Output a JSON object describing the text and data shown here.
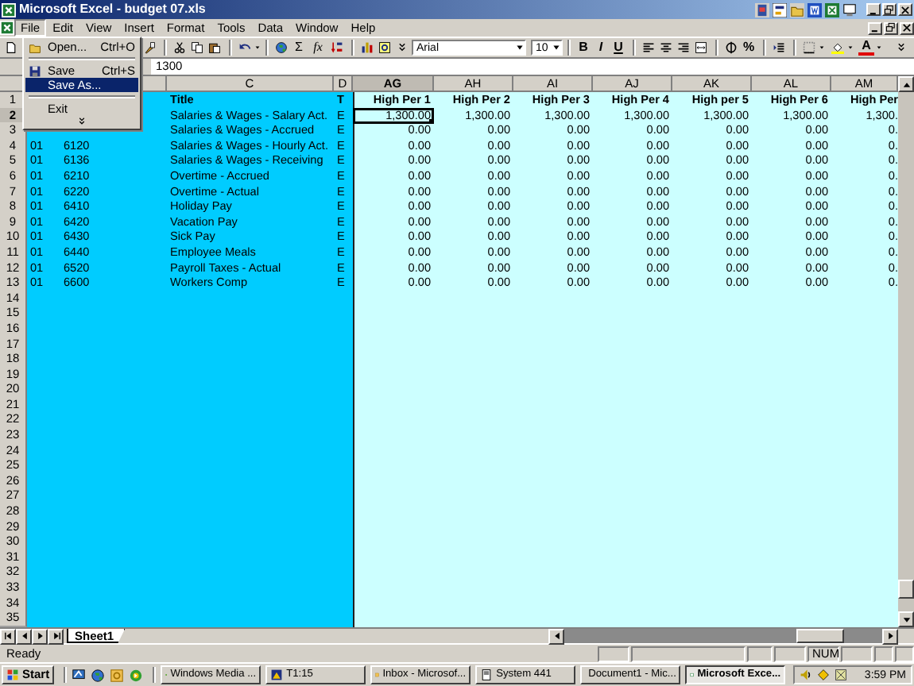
{
  "window": {
    "title": "Microsoft Excel - budget 07.xls"
  },
  "menu_bar": [
    {
      "label": "File",
      "selected": true
    },
    {
      "label": "Edit",
      "selected": false
    },
    {
      "label": "View",
      "selected": false
    },
    {
      "label": "Insert",
      "selected": false
    },
    {
      "label": "Format",
      "selected": false
    },
    {
      "label": "Tools",
      "selected": false
    },
    {
      "label": "Data",
      "selected": false
    },
    {
      "label": "Window",
      "selected": false
    },
    {
      "label": "Help",
      "selected": false
    }
  ],
  "file_menu": [
    {
      "kind": "item",
      "label": "Open...",
      "shortcut": "Ctrl+O",
      "selected": false
    },
    {
      "kind": "separator"
    },
    {
      "kind": "item",
      "label": "Save",
      "shortcut": "Ctrl+S",
      "selected": false
    },
    {
      "kind": "item",
      "label": "Save As...",
      "selected": true
    },
    {
      "kind": "separator"
    },
    {
      "kind": "item",
      "label": "Exit",
      "selected": false
    },
    {
      "kind": "expand"
    }
  ],
  "toolbar": {
    "sum": "Σ",
    "function": "fx",
    "font": "Arial",
    "font_size": "10",
    "bold": "B",
    "italic": "I",
    "underline": "U",
    "percent": "%",
    "font_color": "A"
  },
  "formula_bar": {
    "value": "1300"
  },
  "columns": [
    {
      "label": "C",
      "selected": false
    },
    {
      "label": "D",
      "selected": false
    },
    {
      "label": "AG",
      "selected": true
    },
    {
      "label": "AH",
      "selected": false
    },
    {
      "label": "AI",
      "selected": false
    },
    {
      "label": "AJ",
      "selected": false
    },
    {
      "label": "AK",
      "selected": false
    },
    {
      "label": "AL",
      "selected": false
    },
    {
      "label": "AM",
      "selected": false
    }
  ],
  "rows": [
    {
      "number": "1",
      "kind": "heading",
      "selected": false,
      "c": "Title",
      "d": "T",
      "values": [
        {
          "text": "High Per 1",
          "selected": false
        },
        {
          "text": "High Per 2",
          "selected": false
        },
        {
          "text": "High Per 3",
          "selected": false
        },
        {
          "text": "High Per 4",
          "selected": false
        },
        {
          "text": "High per 5",
          "selected": false
        },
        {
          "text": "High Per 6",
          "selected": false
        },
        {
          "text": "High Per",
          "selected": false
        }
      ]
    },
    {
      "number": "2",
      "kind": "data",
      "selected": true,
      "c": "Salaries & Wages - Salary Act.",
      "d": "E",
      "values": [
        {
          "text": "1,300.00",
          "selected": true
        },
        {
          "text": "1,300.00",
          "selected": false
        },
        {
          "text": "1,300.00",
          "selected": false
        },
        {
          "text": "1,300.00",
          "selected": false
        },
        {
          "text": "1,300.00",
          "selected": false
        },
        {
          "text": "1,300.00",
          "selected": false
        },
        {
          "text": "1,300.",
          "selected": false
        }
      ]
    },
    {
      "number": "3",
      "kind": "data",
      "selected": false,
      "c": "Salaries & Wages - Accrued",
      "d": "E",
      "values": [
        {
          "text": "0.00",
          "selected": false
        },
        {
          "text": "0.00",
          "selected": false
        },
        {
          "text": "0.00",
          "selected": false
        },
        {
          "text": "0.00",
          "selected": false
        },
        {
          "text": "0.00",
          "selected": false
        },
        {
          "text": "0.00",
          "selected": false
        },
        {
          "text": "0.",
          "selected": false
        }
      ]
    },
    {
      "number": "4",
      "kind": "data",
      "selected": false,
      "a": "01",
      "b": "6120",
      "c": "Salaries & Wages - Hourly Act.",
      "d": "E",
      "values": [
        {
          "text": "0.00",
          "selected": false
        },
        {
          "text": "0.00",
          "selected": false
        },
        {
          "text": "0.00",
          "selected": false
        },
        {
          "text": "0.00",
          "selected": false
        },
        {
          "text": "0.00",
          "selected": false
        },
        {
          "text": "0.00",
          "selected": false
        },
        {
          "text": "0.",
          "selected": false
        }
      ]
    },
    {
      "number": "5",
      "kind": "data",
      "selected": false,
      "a": "01",
      "b": "6136",
      "c": "Salaries & Wages - Receiving",
      "d": "E",
      "values": [
        {
          "text": "0.00",
          "selected": false
        },
        {
          "text": "0.00",
          "selected": false
        },
        {
          "text": "0.00",
          "selected": false
        },
        {
          "text": "0.00",
          "selected": false
        },
        {
          "text": "0.00",
          "selected": false
        },
        {
          "text": "0.00",
          "selected": false
        },
        {
          "text": "0.",
          "selected": false
        }
      ]
    },
    {
      "number": "6",
      "kind": "data",
      "selected": false,
      "a": "01",
      "b": "6210",
      "c": "Overtime - Accrued",
      "d": "E",
      "values": [
        {
          "text": "0.00",
          "selected": false
        },
        {
          "text": "0.00",
          "selected": false
        },
        {
          "text": "0.00",
          "selected": false
        },
        {
          "text": "0.00",
          "selected": false
        },
        {
          "text": "0.00",
          "selected": false
        },
        {
          "text": "0.00",
          "selected": false
        },
        {
          "text": "0.",
          "selected": false
        }
      ]
    },
    {
      "number": "7",
      "kind": "data",
      "selected": false,
      "a": "01",
      "b": "6220",
      "c": "Overtime - Actual",
      "d": "E",
      "values": [
        {
          "text": "0.00",
          "selected": false
        },
        {
          "text": "0.00",
          "selected": false
        },
        {
          "text": "0.00",
          "selected": false
        },
        {
          "text": "0.00",
          "selected": false
        },
        {
          "text": "0.00",
          "selected": false
        },
        {
          "text": "0.00",
          "selected": false
        },
        {
          "text": "0.",
          "selected": false
        }
      ]
    },
    {
      "number": "8",
      "kind": "data",
      "selected": false,
      "a": "01",
      "b": "6410",
      "c": "Holiday Pay",
      "d": "E",
      "values": [
        {
          "text": "0.00",
          "selected": false
        },
        {
          "text": "0.00",
          "selected": false
        },
        {
          "text": "0.00",
          "selected": false
        },
        {
          "text": "0.00",
          "selected": false
        },
        {
          "text": "0.00",
          "selected": false
        },
        {
          "text": "0.00",
          "selected": false
        },
        {
          "text": "0.",
          "selected": false
        }
      ]
    },
    {
      "number": "9",
      "kind": "data",
      "selected": false,
      "a": "01",
      "b": "6420",
      "c": "Vacation Pay",
      "d": "E",
      "values": [
        {
          "text": "0.00",
          "selected": false
        },
        {
          "text": "0.00",
          "selected": false
        },
        {
          "text": "0.00",
          "selected": false
        },
        {
          "text": "0.00",
          "selected": false
        },
        {
          "text": "0.00",
          "selected": false
        },
        {
          "text": "0.00",
          "selected": false
        },
        {
          "text": "0.",
          "selected": false
        }
      ]
    },
    {
      "number": "10",
      "kind": "data",
      "selected": false,
      "a": "01",
      "b": "6430",
      "c": "Sick Pay",
      "d": "E",
      "values": [
        {
          "text": "0.00",
          "selected": false
        },
        {
          "text": "0.00",
          "selected": false
        },
        {
          "text": "0.00",
          "selected": false
        },
        {
          "text": "0.00",
          "selected": false
        },
        {
          "text": "0.00",
          "selected": false
        },
        {
          "text": "0.00",
          "selected": false
        },
        {
          "text": "0.",
          "selected": false
        }
      ]
    },
    {
      "number": "11",
      "kind": "data",
      "selected": false,
      "a": "01",
      "b": "6440",
      "c": "Employee Meals",
      "d": "E",
      "values": [
        {
          "text": "0.00",
          "selected": false
        },
        {
          "text": "0.00",
          "selected": false
        },
        {
          "text": "0.00",
          "selected": false
        },
        {
          "text": "0.00",
          "selected": false
        },
        {
          "text": "0.00",
          "selected": false
        },
        {
          "text": "0.00",
          "selected": false
        },
        {
          "text": "0.",
          "selected": false
        }
      ]
    },
    {
      "number": "12",
      "kind": "data",
      "selected": false,
      "a": "01",
      "b": "6520",
      "c": "Payroll Taxes - Actual",
      "d": "E",
      "values": [
        {
          "text": "0.00",
          "selected": false
        },
        {
          "text": "0.00",
          "selected": false
        },
        {
          "text": "0.00",
          "selected": false
        },
        {
          "text": "0.00",
          "selected": false
        },
        {
          "text": "0.00",
          "selected": false
        },
        {
          "text": "0.00",
          "selected": false
        },
        {
          "text": "0.",
          "selected": false
        }
      ]
    },
    {
      "number": "13",
      "kind": "data",
      "selected": false,
      "a": "01",
      "b": "6600",
      "c": "Workers Comp",
      "d": "E",
      "values": [
        {
          "text": "0.00",
          "selected": false
        },
        {
          "text": "0.00",
          "selected": false
        },
        {
          "text": "0.00",
          "selected": false
        },
        {
          "text": "0.00",
          "selected": false
        },
        {
          "text": "0.00",
          "selected": false
        },
        {
          "text": "0.00",
          "selected": false
        },
        {
          "text": "0.",
          "selected": false
        }
      ]
    },
    {
      "number": "14",
      "kind": "empty",
      "selected": false
    },
    {
      "number": "15",
      "kind": "empty",
      "selected": false
    },
    {
      "number": "16",
      "kind": "empty",
      "selected": false
    },
    {
      "number": "17",
      "kind": "empty",
      "selected": false
    },
    {
      "number": "18",
      "kind": "empty",
      "selected": false
    },
    {
      "number": "19",
      "kind": "empty",
      "selected": false
    },
    {
      "number": "20",
      "kind": "empty",
      "selected": false
    },
    {
      "number": "21",
      "kind": "empty",
      "selected": false
    },
    {
      "number": "22",
      "kind": "empty",
      "selected": false
    },
    {
      "number": "23",
      "kind": "empty",
      "selected": false
    },
    {
      "number": "24",
      "kind": "empty",
      "selected": false
    },
    {
      "number": "25",
      "kind": "empty",
      "selected": false
    },
    {
      "number": "26",
      "kind": "empty",
      "selected": false
    },
    {
      "number": "27",
      "kind": "empty",
      "selected": false
    },
    {
      "number": "28",
      "kind": "empty",
      "selected": false
    },
    {
      "number": "29",
      "kind": "empty",
      "selected": false
    },
    {
      "number": "30",
      "kind": "empty",
      "selected": false
    },
    {
      "number": "31",
      "kind": "empty",
      "selected": false
    },
    {
      "number": "32",
      "kind": "empty",
      "selected": false
    },
    {
      "number": "33",
      "kind": "empty",
      "selected": false
    },
    {
      "number": "34",
      "kind": "empty",
      "selected": false
    },
    {
      "number": "35",
      "kind": "empty",
      "selected": false
    }
  ],
  "sheet_tabs": [
    {
      "label": "Sheet1",
      "selected": true
    }
  ],
  "status_bar": {
    "text": "Ready",
    "indicators": [
      "NUM"
    ]
  },
  "taskbar": {
    "start": "Start",
    "tasks": [
      {
        "label": "Windows Media ...",
        "selected": false
      },
      {
        "label": "T1:15",
        "selected": false
      },
      {
        "label": "Inbox - Microsof...",
        "selected": false
      },
      {
        "label": "System 441",
        "selected": false
      },
      {
        "label": "Document1 - Mic...",
        "selected": false
      },
      {
        "label": "Microsoft Exce...",
        "selected": true
      }
    ],
    "clock": "3:59 PM"
  }
}
